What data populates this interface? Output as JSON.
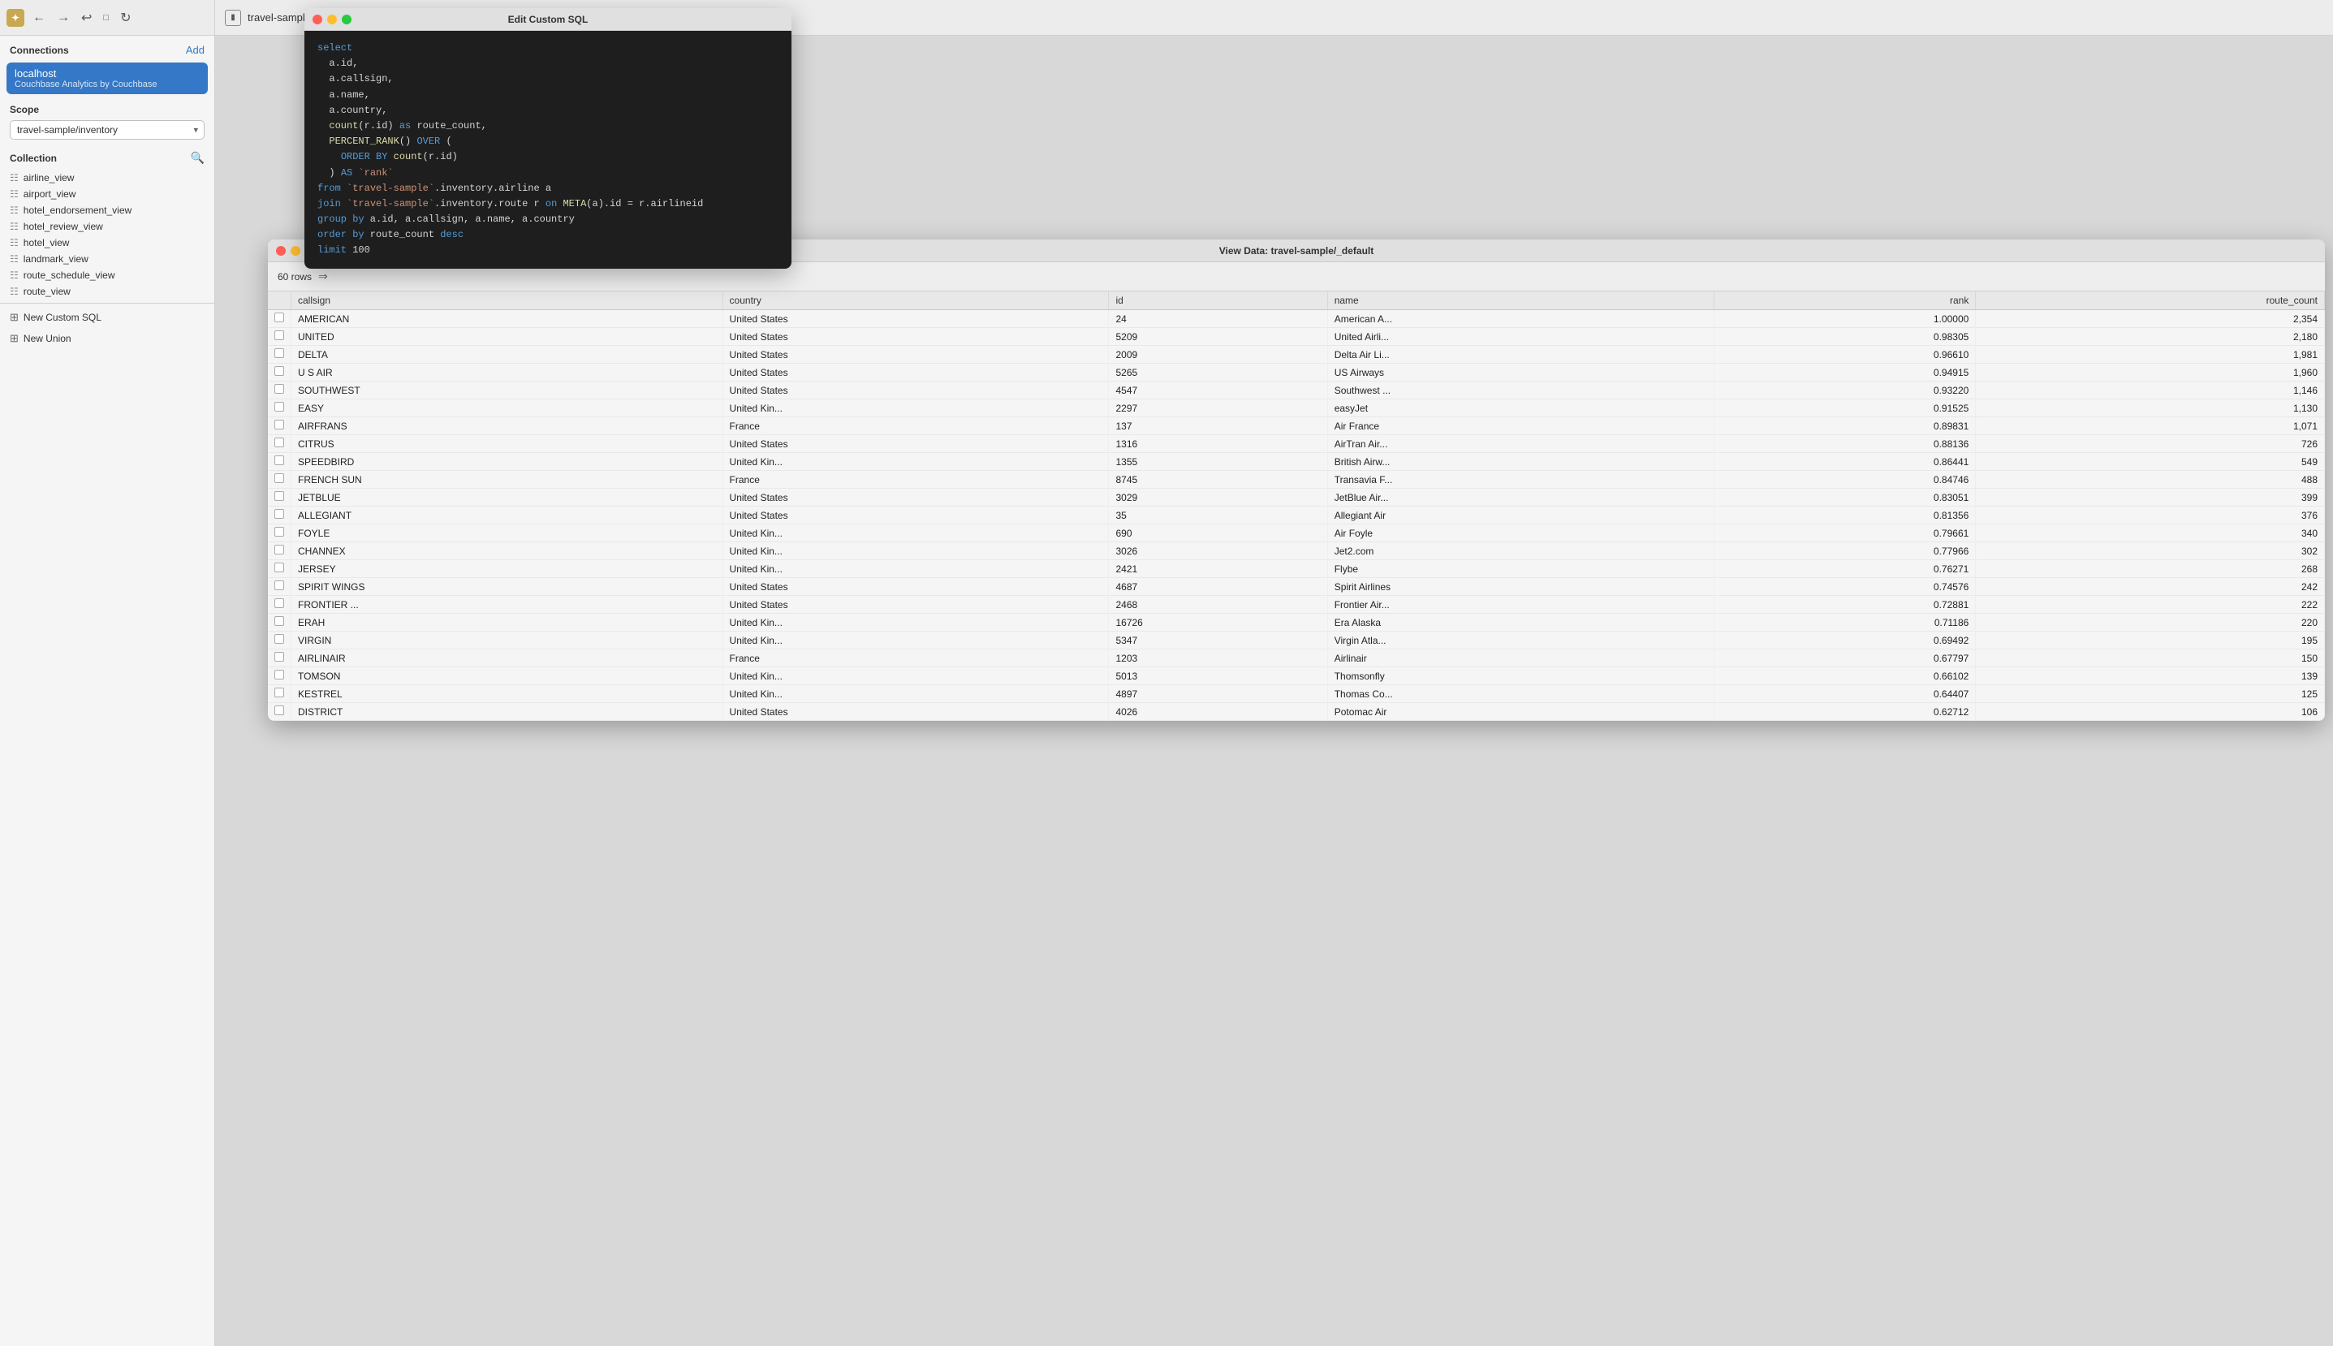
{
  "app": {
    "icon": "✦",
    "title": "travel-sample · inventory"
  },
  "sidebar": {
    "connections_label": "Connections",
    "add_label": "Add",
    "connection": {
      "name": "localhost",
      "subtitle": "Couchbase Analytics by Couchbase"
    },
    "scope_label": "Scope",
    "scope_value": "travel-sample/inventory",
    "collection_label": "Collection",
    "collection_items": [
      {
        "name": "airline_view"
      },
      {
        "name": "airport_view"
      },
      {
        "name": "hotel_endorsement_view"
      },
      {
        "name": "hotel_review_view"
      },
      {
        "name": "hotel_view"
      },
      {
        "name": "landmark_view"
      },
      {
        "name": "route_schedule_view"
      },
      {
        "name": "route_view"
      }
    ],
    "new_custom_sql_label": "New Custom SQL",
    "new_union_label": "New Union"
  },
  "sql_dialog": {
    "title": "Edit Custom SQL",
    "code": "select\n  a.id,\n  a.callsign,\n  a.name,\n  a.country,\n  count(r.id) as route_count,\n  PERCENT_RANK() OVER (\n    ORDER BY count(r.id)\n  ) AS `rank`\nfrom `travel-sample`.inventory.airline a\njoin `travel-sample`.inventory.route r on META(a).id = r.airlineid\ngroup by a.id, a.callsign, a.name, a.country\norder by route_count desc\nlimit 100"
  },
  "data_dialog": {
    "title": "View Data: travel-sample/_default",
    "rows_label": "60 rows",
    "columns": [
      {
        "key": "checkbox",
        "label": "",
        "align": "left"
      },
      {
        "key": "callsign",
        "label": "callsign",
        "align": "left"
      },
      {
        "key": "country",
        "label": "country",
        "align": "left"
      },
      {
        "key": "id",
        "label": "id",
        "align": "left"
      },
      {
        "key": "name",
        "label": "name",
        "align": "left"
      },
      {
        "key": "rank",
        "label": "rank",
        "align": "right"
      },
      {
        "key": "route_count",
        "label": "route_count",
        "align": "right"
      }
    ],
    "rows": [
      {
        "callsign": "AMERICAN",
        "country": "United States",
        "id": "24",
        "name": "American A...",
        "rank": "1.00000",
        "route_count": "2,354"
      },
      {
        "callsign": "UNITED",
        "country": "United States",
        "id": "5209",
        "name": "United Airli...",
        "rank": "0.98305",
        "route_count": "2,180"
      },
      {
        "callsign": "DELTA",
        "country": "United States",
        "id": "2009",
        "name": "Delta Air Li...",
        "rank": "0.96610",
        "route_count": "1,981"
      },
      {
        "callsign": "U S AIR",
        "country": "United States",
        "id": "5265",
        "name": "US Airways",
        "rank": "0.94915",
        "route_count": "1,960"
      },
      {
        "callsign": "SOUTHWEST",
        "country": "United States",
        "id": "4547",
        "name": "Southwest ...",
        "rank": "0.93220",
        "route_count": "1,146"
      },
      {
        "callsign": "EASY",
        "country": "United Kin...",
        "id": "2297",
        "name": "easyJet",
        "rank": "0.91525",
        "route_count": "1,130"
      },
      {
        "callsign": "AIRFRANS",
        "country": "France",
        "id": "137",
        "name": "Air France",
        "rank": "0.89831",
        "route_count": "1,071"
      },
      {
        "callsign": "CITRUS",
        "country": "United States",
        "id": "1316",
        "name": "AirTran Air...",
        "rank": "0.88136",
        "route_count": "726"
      },
      {
        "callsign": "SPEEDBIRD",
        "country": "United Kin...",
        "id": "1355",
        "name": "British Airw...",
        "rank": "0.86441",
        "route_count": "549"
      },
      {
        "callsign": "FRENCH SUN",
        "country": "France",
        "id": "8745",
        "name": "Transavia F...",
        "rank": "0.84746",
        "route_count": "488"
      },
      {
        "callsign": "JETBLUE",
        "country": "United States",
        "id": "3029",
        "name": "JetBlue Air...",
        "rank": "0.83051",
        "route_count": "399"
      },
      {
        "callsign": "ALLEGIANT",
        "country": "United States",
        "id": "35",
        "name": "Allegiant Air",
        "rank": "0.81356",
        "route_count": "376"
      },
      {
        "callsign": "FOYLE",
        "country": "United Kin...",
        "id": "690",
        "name": "Air Foyle",
        "rank": "0.79661",
        "route_count": "340"
      },
      {
        "callsign": "CHANNEX",
        "country": "United Kin...",
        "id": "3026",
        "name": "Jet2.com",
        "rank": "0.77966",
        "route_count": "302"
      },
      {
        "callsign": "JERSEY",
        "country": "United Kin...",
        "id": "2421",
        "name": "Flybe",
        "rank": "0.76271",
        "route_count": "268"
      },
      {
        "callsign": "SPIRIT WINGS",
        "country": "United States",
        "id": "4687",
        "name": "Spirit Airlines",
        "rank": "0.74576",
        "route_count": "242"
      },
      {
        "callsign": "FRONTIER ...",
        "country": "United States",
        "id": "2468",
        "name": "Frontier Air...",
        "rank": "0.72881",
        "route_count": "222"
      },
      {
        "callsign": "ERAH",
        "country": "United Kin...",
        "id": "16726",
        "name": "Era Alaska",
        "rank": "0.71186",
        "route_count": "220"
      },
      {
        "callsign": "VIRGIN",
        "country": "United Kin...",
        "id": "5347",
        "name": "Virgin Atla...",
        "rank": "0.69492",
        "route_count": "195"
      },
      {
        "callsign": "AIRLINAIR",
        "country": "France",
        "id": "1203",
        "name": "Airlinair",
        "rank": "0.67797",
        "route_count": "150"
      },
      {
        "callsign": "TOMSON",
        "country": "United Kin...",
        "id": "5013",
        "name": "Thomsonfly",
        "rank": "0.66102",
        "route_count": "139"
      },
      {
        "callsign": "KESTREL",
        "country": "United Kin...",
        "id": "4897",
        "name": "Thomas Co...",
        "rank": "0.64407",
        "route_count": "125"
      },
      {
        "callsign": "DISTRICT",
        "country": "United States",
        "id": "4026",
        "name": "Potomac Air",
        "rank": "0.62712",
        "route_count": "106"
      }
    ]
  }
}
